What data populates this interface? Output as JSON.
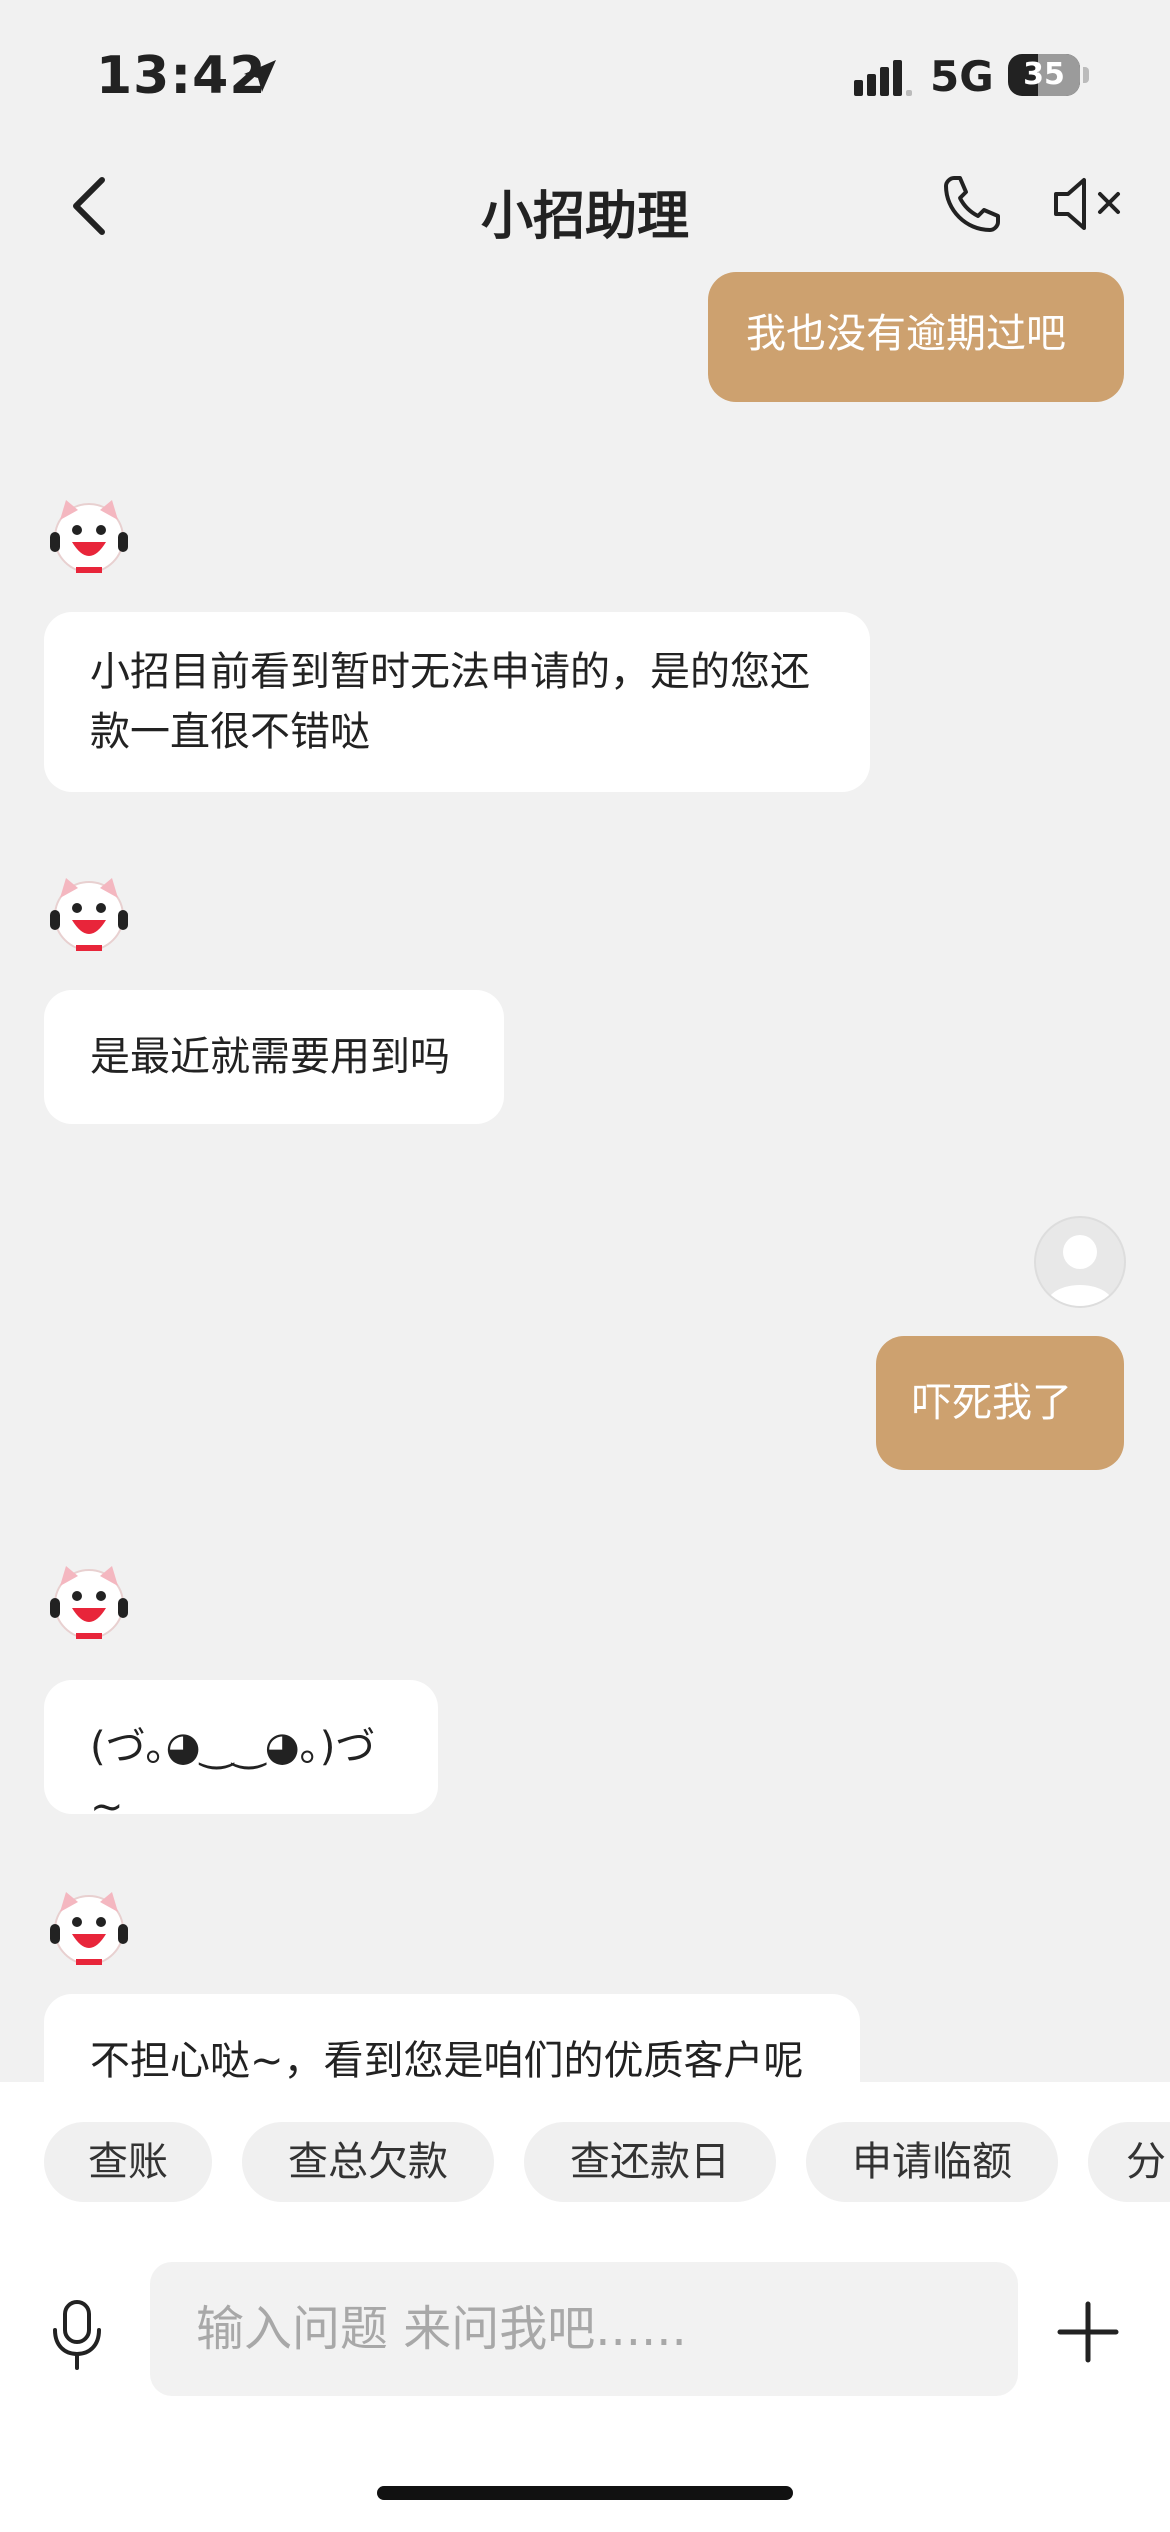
{
  "status": {
    "time": "13:42",
    "network": "5G",
    "battery": "35"
  },
  "header": {
    "title": "小招助理"
  },
  "messages": [
    {
      "side": "user",
      "text": "我也没有逾期过吧"
    },
    {
      "side": "bot",
      "text": "小招目前看到暂时无法申请的，是的您还款一直很不错哒"
    },
    {
      "side": "bot",
      "text": "是最近就需要用到吗"
    },
    {
      "side": "user",
      "text": "吓死我了"
    },
    {
      "side": "bot",
      "text": "(づ｡◕‿‿◕｡)づ~"
    },
    {
      "side": "bot",
      "text": "不担心哒~，看到您是咱们的优质客户呢"
    }
  ],
  "quick_actions": [
    "查账",
    "查总欠款",
    "查还款日",
    "申请临额",
    "分"
  ],
  "input": {
    "placeholder": "输入问题 来问我吧......",
    "value": ""
  },
  "colors": {
    "user_bubble": "#cda16f",
    "bot_bubble": "#ffffff",
    "background": "#f1f1f1"
  },
  "icons": [
    "location-arrow-icon",
    "signal-icon",
    "back-chevron-icon",
    "phone-icon",
    "speaker-mute-icon",
    "bot-avatar-icon",
    "user-avatar-icon",
    "microphone-icon",
    "plus-icon"
  ]
}
